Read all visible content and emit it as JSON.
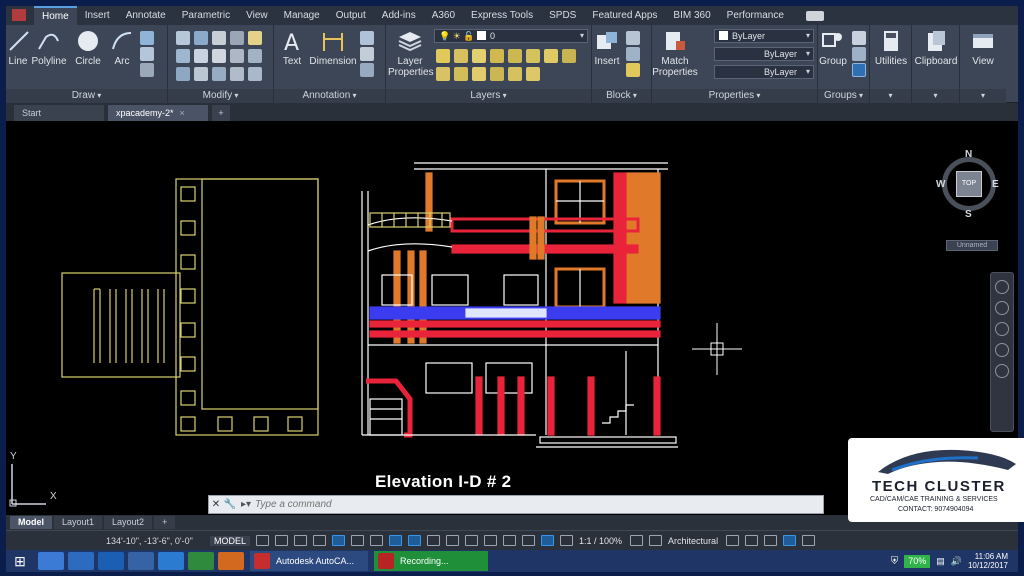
{
  "ribbon_tabs": [
    "Home",
    "Insert",
    "Annotate",
    "Parametric",
    "View",
    "Manage",
    "Output",
    "Add-ins",
    "A360",
    "Express Tools",
    "SPDS",
    "Featured Apps",
    "BIM 360",
    "Performance"
  ],
  "active_ribbon_tab": "Home",
  "panels": {
    "draw": {
      "title": "Draw",
      "buttons": [
        "Line",
        "Polyline",
        "Circle",
        "Arc"
      ]
    },
    "modify": {
      "title": "Modify"
    },
    "annotation": {
      "title": "Annotation",
      "buttons": [
        "Text",
        "Dimension"
      ]
    },
    "layers": {
      "title": "Layers",
      "button": "Layer Properties",
      "current_layer": "0"
    },
    "block": {
      "title": "Block",
      "button": "Insert"
    },
    "properties": {
      "title": "Properties",
      "button": "Match Properties",
      "color": "ByLayer",
      "linetype": "ByLayer",
      "lineweight": "ByLayer"
    },
    "groups": {
      "title": "Groups",
      "button": "Group"
    },
    "utilities": {
      "button": "Utilities"
    },
    "clipboard": {
      "button": "Clipboard"
    },
    "view": {
      "button": "View"
    }
  },
  "doc_tabs": [
    "Start",
    "xpacademy-2*"
  ],
  "active_doc_tab": "xpacademy-2*",
  "viewcube": {
    "north": "N",
    "south": "S",
    "east": "E",
    "west": "W",
    "face": "TOP",
    "wcs": "Unnamed"
  },
  "drawing_title": "Elevation I-D # 2",
  "ucs": {
    "x": "X",
    "y": "Y"
  },
  "command_line": {
    "placeholder": "Type a command"
  },
  "layout_tabs": [
    "Model",
    "Layout1",
    "Layout2"
  ],
  "active_layout": "Model",
  "status": {
    "coordinates": "134'-10\", -13'-6\", 0'-0\"",
    "space": "MODEL",
    "annotation_scale": "1:1 / 100%",
    "units": "Architectural"
  },
  "taskbar": {
    "windows": [
      "Autodesk AutoCA...",
      "Recording..."
    ],
    "battery": "70%",
    "time": "11:06 AM",
    "date": "10/12/2017"
  },
  "watermark": {
    "title": "TECH CLUSTER",
    "subtitle": "CAD/CAM/CAE TRAINING & SERVICES",
    "contact": "CONTACT: 9074904094"
  },
  "colors": {
    "drawing_yellow": "#d8d070",
    "drawing_white": "#ffffff",
    "drawing_red": "#e8233a",
    "drawing_orange": "#e07a2a",
    "drawing_blue": "#3b3cf0",
    "ribbon_bg": "#3d4656"
  }
}
